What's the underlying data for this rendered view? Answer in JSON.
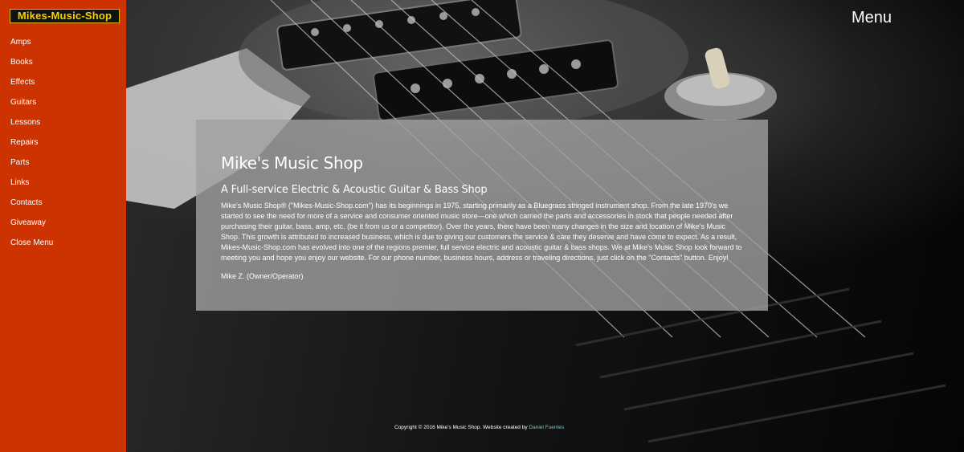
{
  "logo": "Mikes-Music-Shop",
  "sidebar": {
    "items": [
      {
        "label": "Amps"
      },
      {
        "label": "Books"
      },
      {
        "label": "Effects"
      },
      {
        "label": "Guitars"
      },
      {
        "label": "Lessons"
      },
      {
        "label": "Repairs"
      },
      {
        "label": "Parts"
      },
      {
        "label": "Links"
      },
      {
        "label": "Contacts"
      },
      {
        "label": "Giveaway"
      },
      {
        "label": "Close Menu"
      }
    ]
  },
  "header": {
    "menu_label": "Menu"
  },
  "main": {
    "title": "Mike's Music Shop",
    "subtitle": "A Full-service Electric & Acoustic Guitar & Bass Shop",
    "body": "Mike's Music Shop® (\"Mikes-Music-Shop.com\") has its beginnings in 1975, starting primarily as a Bluegrass stringed instrument shop. From the late 1970's we started to see the need for more of a service and consumer oriented music store—one which carried the parts and accessories in stock that people needed after purchasing their guitar, bass, amp, etc. (be it from us or a competitor). Over the years, there have been many changes in the size and location of Mike's Music Shop. This growth is attributed to increased business, which is due to giving our customers the service & care they deserve and have come to expect. As a result, Mikes-Music-Shop.com has evolved into one of the regions premier, full service electric and acoustic guitar & bass shops. We at Mike's Music Shop look forward to meeting you and hope you enjoy our website. For our phone number, business hours, address or traveling directions, just click on the \"Contacts\" button. Enjoy!",
    "signature": "Mike Z. (Owner/Operator)"
  },
  "footer": {
    "copyright": "Copyright © 2016 Mike's Music Shop. Website created by",
    "author": "Daniel Fuentes"
  },
  "colors": {
    "sidebar_bg": "#cc3300",
    "logo_text": "#f2d200",
    "card_bg": "#a0a0a0",
    "footer_link": "#7fc6c6"
  }
}
